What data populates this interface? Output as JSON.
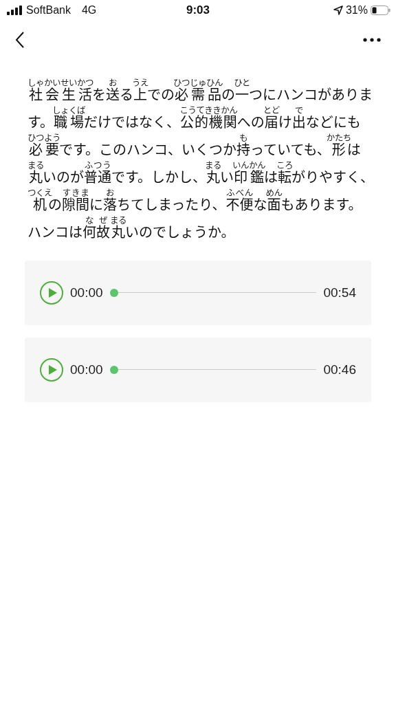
{
  "status_bar": {
    "carrier": "SoftBank",
    "network": "4G",
    "time": "9:03",
    "battery": "31%"
  },
  "article": {
    "segments": [
      {
        "text": "社会生活",
        "ruby": "しゃかいせいかつ"
      },
      {
        "text": "を"
      },
      {
        "text": "送",
        "ruby": "お"
      },
      {
        "text": "る"
      },
      {
        "text": "上",
        "ruby": "うえ"
      },
      {
        "text": "での"
      },
      {
        "text": "必需品",
        "ruby": "ひつじゅひん"
      },
      {
        "text": "の"
      },
      {
        "text": "一",
        "ruby": "ひと"
      },
      {
        "text": "つにハンコがあります。"
      },
      {
        "text": "職場",
        "ruby": "しょくば"
      },
      {
        "text": "だけではなく、"
      },
      {
        "text": "公的機関",
        "ruby": "こうてききかん"
      },
      {
        "text": "への"
      },
      {
        "text": "届",
        "ruby": "とど"
      },
      {
        "text": "け"
      },
      {
        "text": "出",
        "ruby": "で"
      },
      {
        "text": "などにも"
      },
      {
        "text": "必要",
        "ruby": "ひつよう"
      },
      {
        "text": "です。このハンコ、いくつか"
      },
      {
        "text": "持",
        "ruby": "も"
      },
      {
        "text": "っていても、"
      },
      {
        "text": "形",
        "ruby": "かたち"
      },
      {
        "text": "は"
      },
      {
        "text": "丸",
        "ruby": "まる"
      },
      {
        "text": "いのが"
      },
      {
        "text": "普通",
        "ruby": "ふつう"
      },
      {
        "text": "です。しかし、"
      },
      {
        "text": "丸",
        "ruby": "まる"
      },
      {
        "text": "い"
      },
      {
        "text": "印鑑",
        "ruby": "いんかん"
      },
      {
        "text": "は"
      },
      {
        "text": "転",
        "ruby": "ころ"
      },
      {
        "text": "がりやすく、"
      },
      {
        "text": "机",
        "ruby": "つくえ"
      },
      {
        "text": "の"
      },
      {
        "text": "隙間",
        "ruby": "すきま"
      },
      {
        "text": "に"
      },
      {
        "text": "落",
        "ruby": "お"
      },
      {
        "text": "ちてしまったり、"
      },
      {
        "text": "不便",
        "ruby": "ふべん"
      },
      {
        "text": "な"
      },
      {
        "text": "面",
        "ruby": "めん"
      },
      {
        "text": "もあります。ハンコは"
      },
      {
        "text": "何故",
        "ruby": "なぜ"
      },
      {
        "text": "丸",
        "ruby": "まる"
      },
      {
        "text": "いのでしょうか。"
      }
    ]
  },
  "players": [
    {
      "current": "00:00",
      "duration": "00:54",
      "level": 0
    },
    {
      "current": "00:00",
      "duration": "00:46",
      "level": 0
    }
  ]
}
